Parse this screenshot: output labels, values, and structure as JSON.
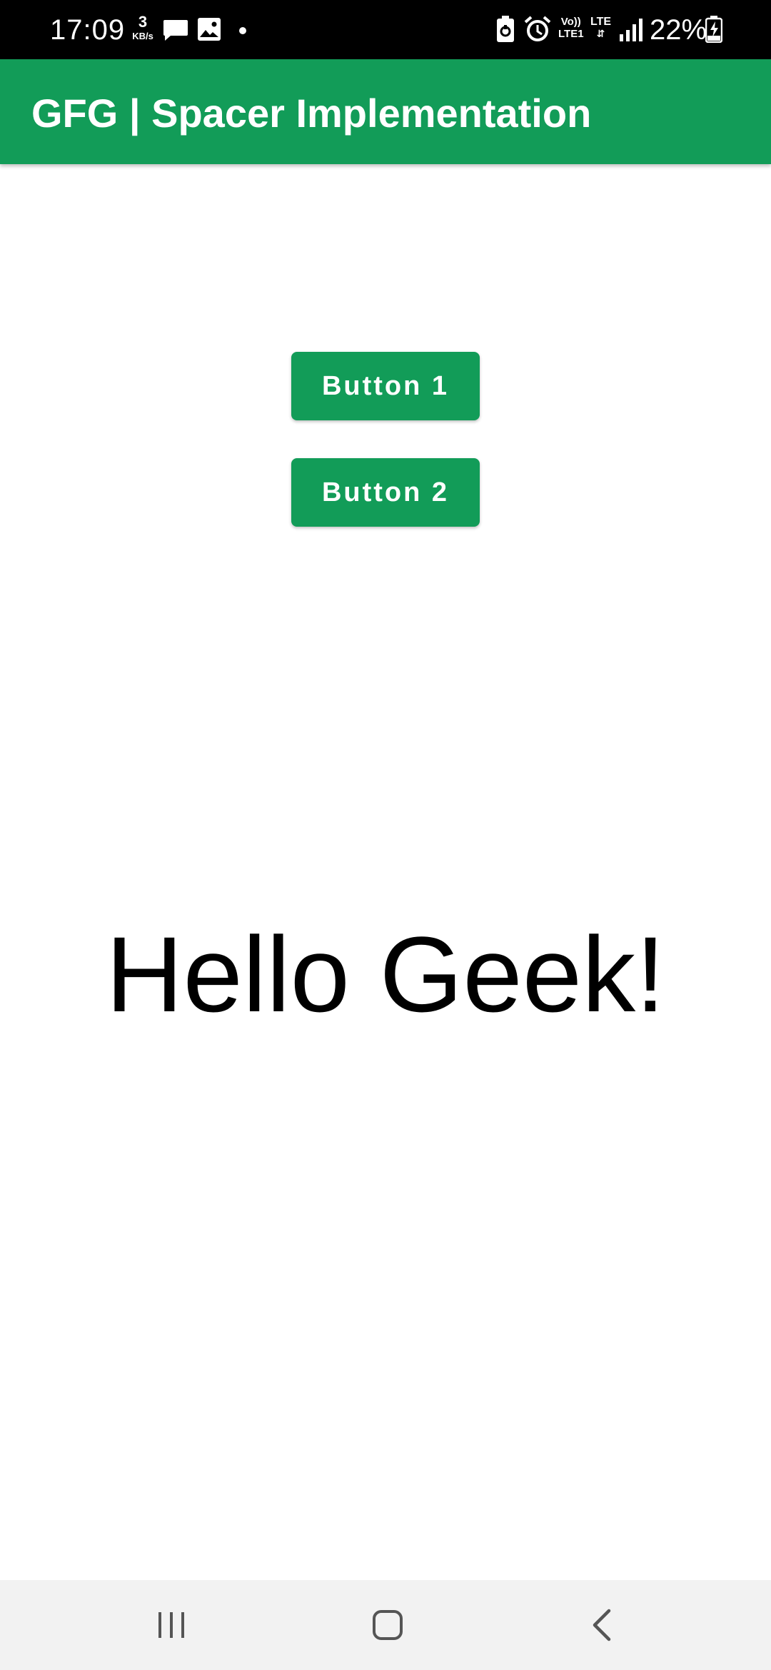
{
  "status_bar": {
    "time": "17:09",
    "net_speed_value": "3",
    "net_speed_unit": "KB/s",
    "notification_icons": [
      "message-icon",
      "image-icon",
      "dot-icon"
    ],
    "system_icons": [
      "battery-saver-icon",
      "alarm-icon",
      "volte-icon",
      "lte-data-icon",
      "signal-icon",
      "charging-battery-icon"
    ],
    "volte_line1": "Vo))",
    "volte_line2": "LTE1",
    "lte_label": "LTE",
    "battery_percent": "22%"
  },
  "app_bar": {
    "title": "GFG | Spacer Implementation",
    "color": "#129c58"
  },
  "main": {
    "button_1_label": "Button 1",
    "button_2_label": "Button 2",
    "hello_text": "Hello Geek!"
  },
  "nav_bar": {
    "items": [
      "recents-icon",
      "home-icon",
      "back-icon"
    ]
  }
}
